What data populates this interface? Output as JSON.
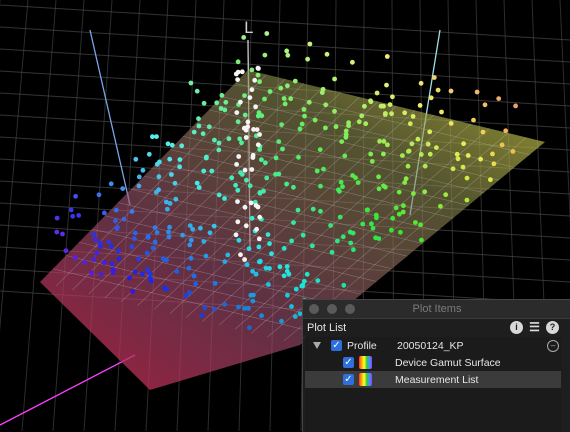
{
  "viewer": {
    "axis_label": "L"
  },
  "panel": {
    "window_title": "Plot Items",
    "header_label": "Plot List",
    "icons": [
      "info-icon",
      "sliders-icon",
      "help-icon"
    ],
    "rows": [
      {
        "kind": "group",
        "name": "Profile",
        "value": "20050124_KP",
        "checked": true,
        "expanded": true
      },
      {
        "kind": "item",
        "name": "Device Gamut Surface",
        "checked": true,
        "selected": false
      },
      {
        "kind": "item",
        "name": "Measurement List",
        "checked": true,
        "selected": true
      }
    ]
  },
  "colors": {
    "grid": "#4a4a4a",
    "panel_bg": "#1e1e1e",
    "checkbox": "#2f6fdb",
    "selection": "#3b3b3b"
  }
}
